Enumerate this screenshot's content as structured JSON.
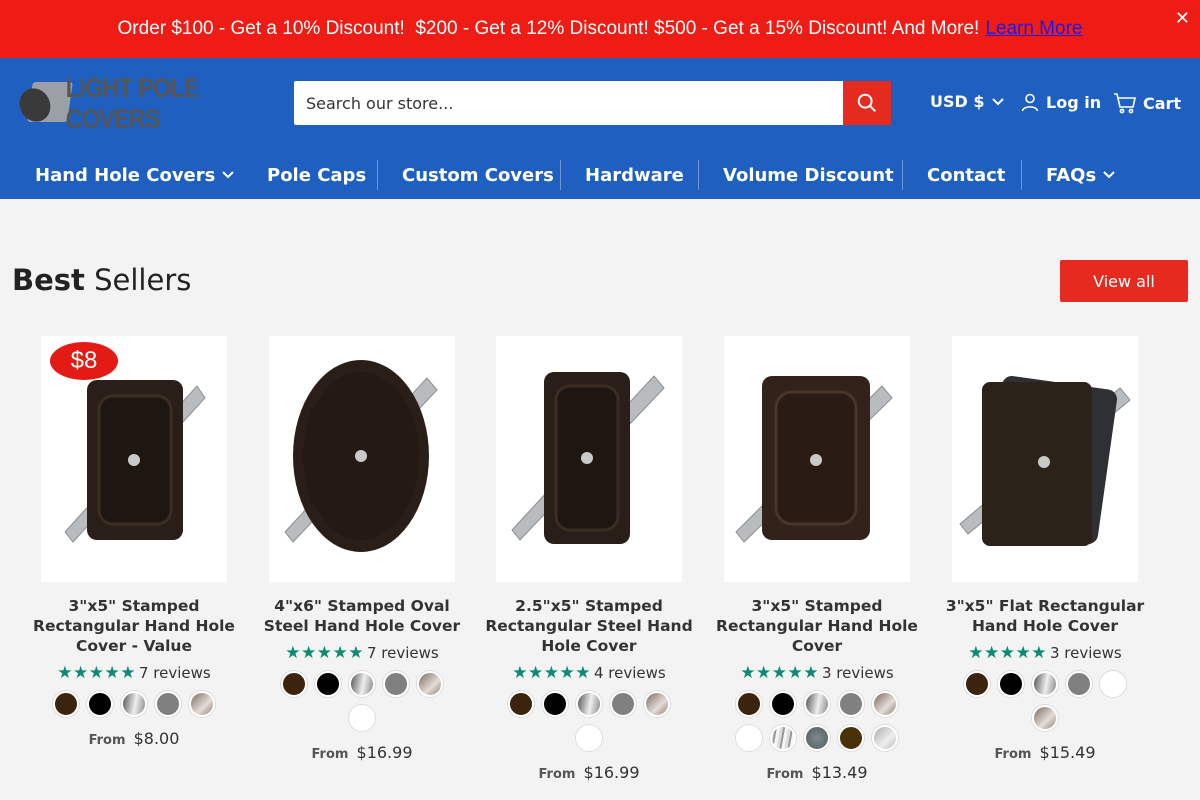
{
  "announcement": {
    "message": "Order $100 - Get a 10% Discount!  $200 - Get a 12% Discount! $500 - Get a 15% Discount! And More!",
    "link": "Learn More",
    "close": "✕"
  },
  "header": {
    "logo_text": "LIGHT POLE COVERS",
    "search_placeholder": "Search our store...",
    "currency": "USD $",
    "login": "Log in",
    "cart": "Cart"
  },
  "nav": [
    {
      "label": "Hand Hole Covers",
      "has_dropdown": true
    },
    {
      "label": "Pole Caps",
      "has_dropdown": false
    },
    {
      "label": "Custom Covers",
      "has_dropdown": false
    },
    {
      "label": "Hardware",
      "has_dropdown": false
    },
    {
      "label": "Volume Discount",
      "has_dropdown": false
    },
    {
      "label": "Contact",
      "has_dropdown": false
    },
    {
      "label": "FAQs",
      "has_dropdown": true
    }
  ],
  "section": {
    "title_bold": "Best",
    "title_rest": "Sellers",
    "view_all": "View all"
  },
  "products": [
    {
      "title": "3\"x5\" Stamped Rectangular Hand Hole Cover - Value",
      "badge": "$8",
      "stars": "★★★★★",
      "reviews": "7 reviews",
      "from": "From",
      "price": "$8.00",
      "swatches": [
        "#3b230e",
        "#000000",
        "silver",
        "#808080",
        "bronze"
      ]
    },
    {
      "title": "4\"x6\" Stamped Oval Steel Hand Hole Cover",
      "stars": "★★★★★",
      "reviews": "7 reviews",
      "from": "From",
      "price": "$16.99",
      "swatches": [
        "#3b230e",
        "#000000",
        "silver",
        "#808080",
        "bronze",
        "#ffffff"
      ]
    },
    {
      "title": "2.5\"x5\" Stamped Rectangular Steel Hand Hole Cover",
      "stars": "★★★★★",
      "reviews": "4 reviews",
      "from": "From",
      "price": "$16.99",
      "swatches": [
        "#3b230e",
        "#000000",
        "silver",
        "#808080",
        "bronze",
        "#ffffff"
      ]
    },
    {
      "title": "3\"x5\" Stamped Rectangular Hand Hole Cover",
      "stars": "★★★★★",
      "reviews": "3 reviews",
      "from": "From",
      "price": "$13.49",
      "swatches": [
        "#3b230e",
        "#000000",
        "silver",
        "#808080",
        "bronze",
        "#ffffff",
        "brushed",
        "#5f6b6e",
        "#4a3208",
        "#c8c8c8"
      ]
    },
    {
      "title": "3\"x5\" Flat Rectangular Hand Hole Cover",
      "stars": "★★★★★",
      "reviews": "3 reviews",
      "from": "From",
      "price": "$15.49",
      "swatches": [
        "#3b230e",
        "#000000",
        "silver",
        "#808080",
        "#ffffff",
        "bronze"
      ]
    }
  ],
  "colors": {
    "announce_bg": "#ee1c14",
    "header_bg": "#1f5fbf",
    "accent_red": "#e52b20",
    "star_green": "#0e8a73"
  }
}
